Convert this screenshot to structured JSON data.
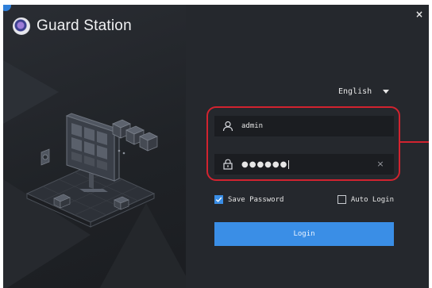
{
  "window": {
    "title": "Guard Station",
    "close_label": "×"
  },
  "language": {
    "selected": "English"
  },
  "username": {
    "value": "admin",
    "icon": "user-icon"
  },
  "password": {
    "masked_value": "●●●●●●",
    "icon": "lock-icon",
    "clear_label": "×"
  },
  "options": {
    "save_password": {
      "label": "Save Password",
      "checked": true
    },
    "auto_login": {
      "label": "Auto Login",
      "checked": false
    }
  },
  "login": {
    "label": "Login"
  },
  "colors": {
    "accent": "#3a8ee6",
    "highlight": "#d2232f",
    "background": "#25282d"
  }
}
